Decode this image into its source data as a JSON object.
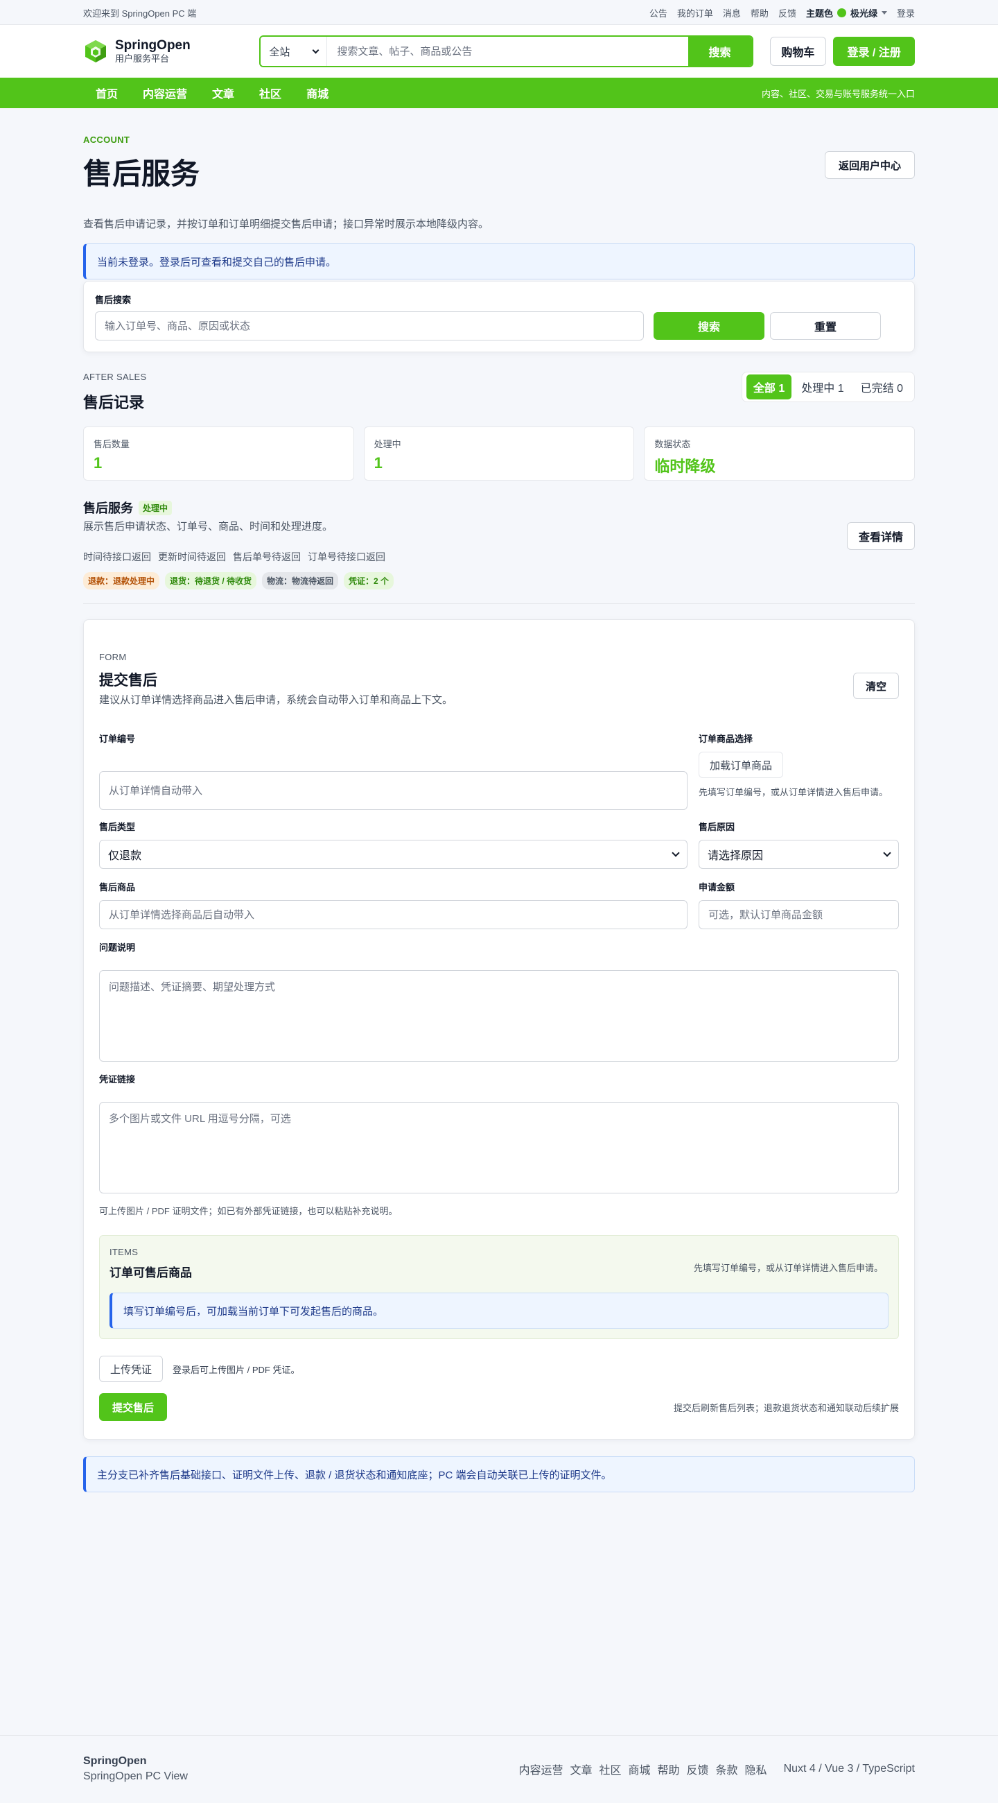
{
  "topbar": {
    "welcome": "欢迎来到 SpringOpen PC 端",
    "links": [
      "公告",
      "我的订单",
      "消息",
      "帮助",
      "反馈"
    ],
    "theme_label": "主题色",
    "theme_value": "极光绿",
    "login": "登录"
  },
  "header": {
    "brand": "SpringOpen",
    "brand_sub": "用户服务平台",
    "scope": "全站",
    "search_placeholder": "搜索文章、帖子、商品或公告",
    "search_button": "搜索",
    "cart": "购物车",
    "login_register": "登录 / 注册"
  },
  "nav": {
    "items": [
      "首页",
      "内容运营",
      "文章",
      "社区",
      "商城"
    ],
    "slogan": "内容、社区、交易与账号服务统一入口"
  },
  "page": {
    "eyebrow": "ACCOUNT",
    "title": "售后服务",
    "back_button": "返回用户中心",
    "description": "查看售后申请记录，并按订单和订单明细提交售后申请；接口异常时展示本地降级内容。",
    "login_notice": "当前未登录。登录后可查看和提交自己的售后申请。"
  },
  "search": {
    "label": "售后搜索",
    "placeholder": "输入订单号、商品、原因或状态",
    "search_button": "搜索",
    "reset_button": "重置"
  },
  "records": {
    "eyebrow": "AFTER SALES",
    "title": "售后记录",
    "filters": [
      "全部 1",
      "处理中 1",
      "已完结 0"
    ],
    "stats": [
      {
        "label": "售后数量",
        "value": "1"
      },
      {
        "label": "处理中",
        "value": "1"
      },
      {
        "label": "数据状态",
        "value": "临时降级"
      }
    ],
    "item": {
      "title": "售后服务",
      "badge": "处理中",
      "desc": "展示售后申请状态、订单号、商品、时间和处理进度。",
      "meta": [
        "时间待接口返回",
        "更新时间待返回",
        "售后单号待返回",
        "订单号待接口返回"
      ],
      "tags": [
        "退款：退款处理中",
        "退货：待退货 / 待收货",
        "物流：物流待返回",
        "凭证：2 个"
      ],
      "detail_button": "查看详情"
    }
  },
  "form": {
    "eyebrow": "FORM",
    "title": "提交售后",
    "hint": "建议从订单详情选择商品进入售后申请，系统会自动带入订单和商品上下文。",
    "clear_button": "清空",
    "order_no_label": "订单编号",
    "order_no_placeholder": "从订单详情自动带入",
    "order_item_label": "订单商品选择",
    "load_items_button": "加载订单商品",
    "order_item_hint": "先填写订单编号，或从订单详情进入售后申请。",
    "type_label": "售后类型",
    "type_value": "仅退款",
    "reason_label": "售后原因",
    "reason_value": "请选择原因",
    "goods_label": "售后商品",
    "goods_placeholder": "从订单详情选择商品后自动带入",
    "amount_label": "申请金额",
    "amount_placeholder": "可选，默认订单商品金额",
    "problem_label": "问题说明",
    "problem_placeholder": "问题描述、凭证摘要、期望处理方式",
    "proof_label": "凭证链接",
    "proof_placeholder": "多个图片或文件 URL 用逗号分隔，可选",
    "proof_hint": "可上传图片 / PDF 证明文件；如已有外部凭证链接，也可以粘贴补充说明。",
    "items": {
      "eyebrow": "ITEMS",
      "title": "订单可售后商品",
      "right_hint": "先填写订单编号，或从订单详情进入售后申请。",
      "notice": "填写订单编号后，可加载当前订单下可发起售后的商品。"
    },
    "upload_button": "上传凭证",
    "upload_hint": "登录后可上传图片 / PDF 凭证。",
    "submit_button": "提交售后",
    "submit_hint": "提交后刷新售后列表；退款退货状态和通知联动后续扩展"
  },
  "bottom_notice": "主分支已补齐售后基础接口、证明文件上传、退款 / 退货状态和通知底座；PC 端会自动关联已上传的证明文件。",
  "footer": {
    "brand": "SpringOpen",
    "sub": "SpringOpen PC View",
    "links": [
      "内容运营",
      "文章",
      "社区",
      "商城",
      "帮助",
      "反馈",
      "条款",
      "隐私"
    ],
    "version": "Nuxt 4 / Vue 3 / TypeScript"
  },
  "colors": {
    "accent": "#52c41a",
    "info": "#2563eb"
  }
}
